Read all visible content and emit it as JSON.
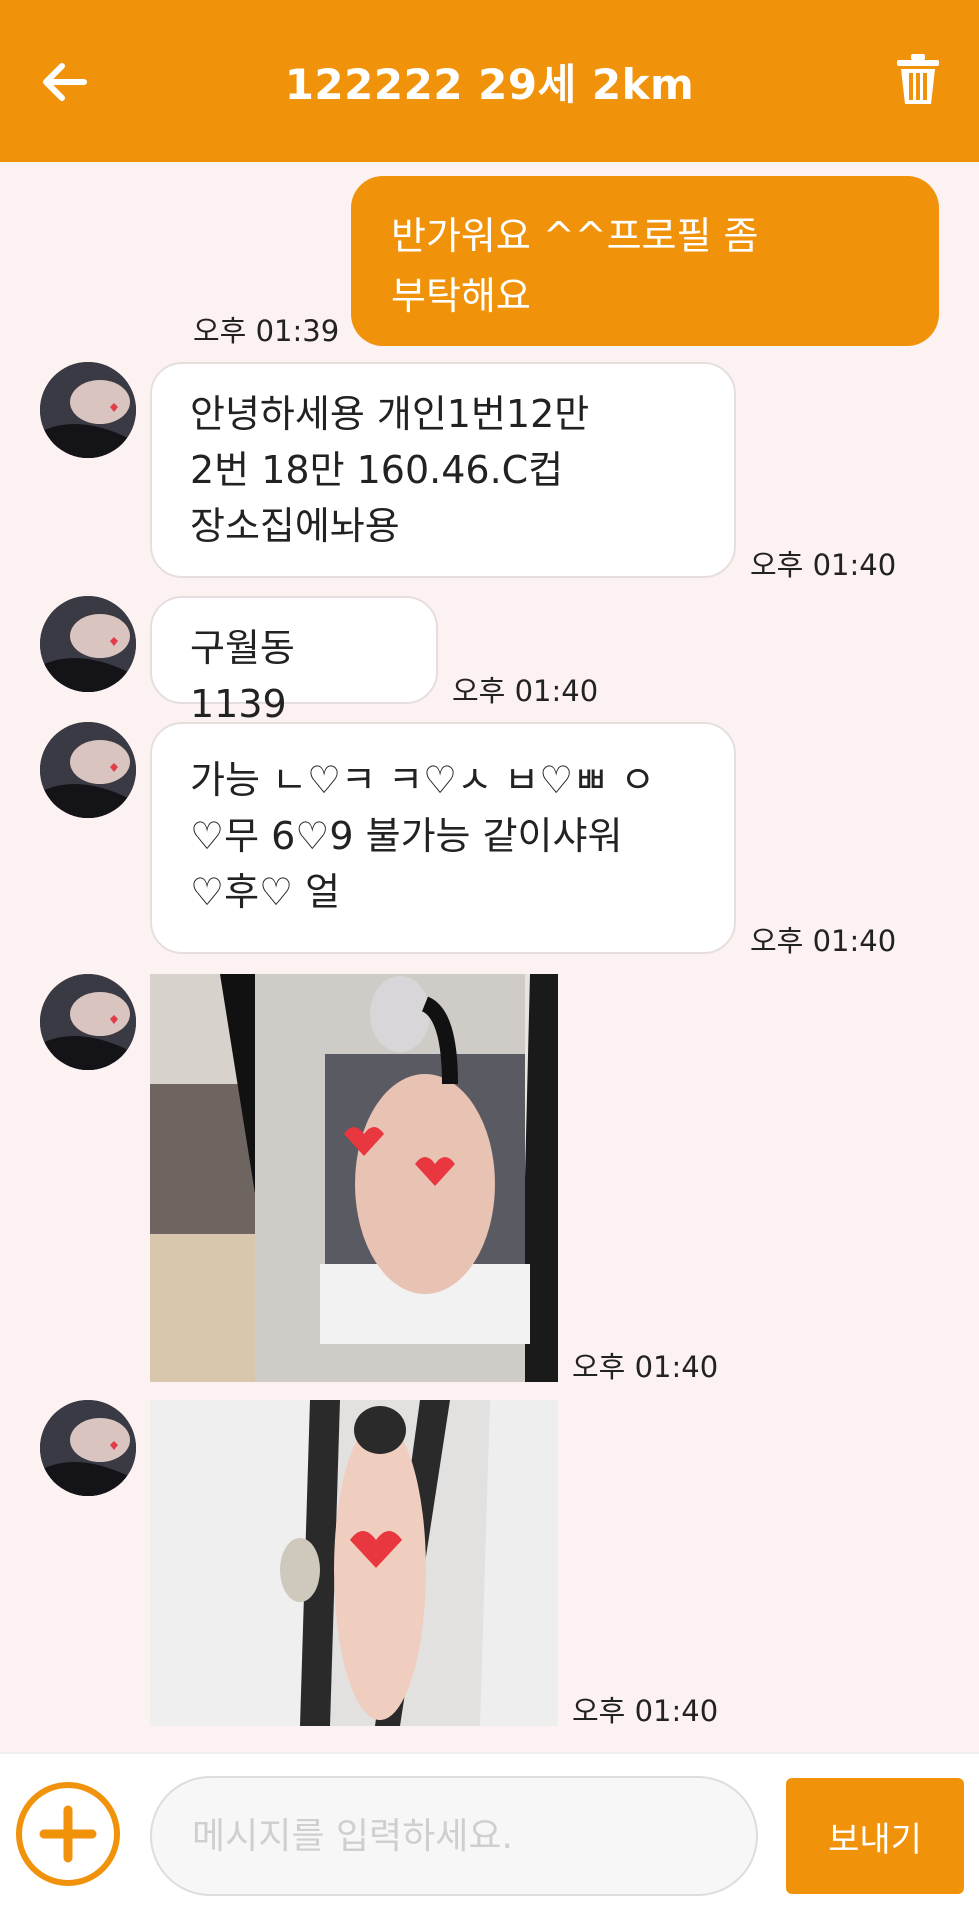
{
  "header": {
    "title": "122222 29세 2km",
    "back_icon": "arrow-left-icon",
    "delete_icon": "trash-icon",
    "bg_color": "#f0920a"
  },
  "messages": [
    {
      "side": "out",
      "text": "반가워요 ^^프로필 좀\n부탁해요",
      "time": "오후 01:39"
    },
    {
      "side": "in",
      "text": "안녕하세용 개인1번12만\n2번 18만 160.46.C컵\n장소집에놔용",
      "time": "오후 01:40"
    },
    {
      "side": "in",
      "text": "구월동 1139",
      "time": "오후 01:40"
    },
    {
      "side": "in",
      "text": "가능 ㄴ♡ㅋ ㅋ♡ㅅ ㅂ♡ㅃ ㅇ\n♡무  6♡9     불가능 같이샤워\n♡후♡ 얼",
      "time": "오후 01:40"
    },
    {
      "side": "in",
      "type": "image",
      "time": "오후 01:40"
    },
    {
      "side": "in",
      "type": "image",
      "time": "오후 01:40"
    }
  ],
  "composer": {
    "placeholder": "메시지를 입력하세요.",
    "value": "",
    "send_label": "보내기",
    "attach_icon": "plus-circle-icon"
  }
}
